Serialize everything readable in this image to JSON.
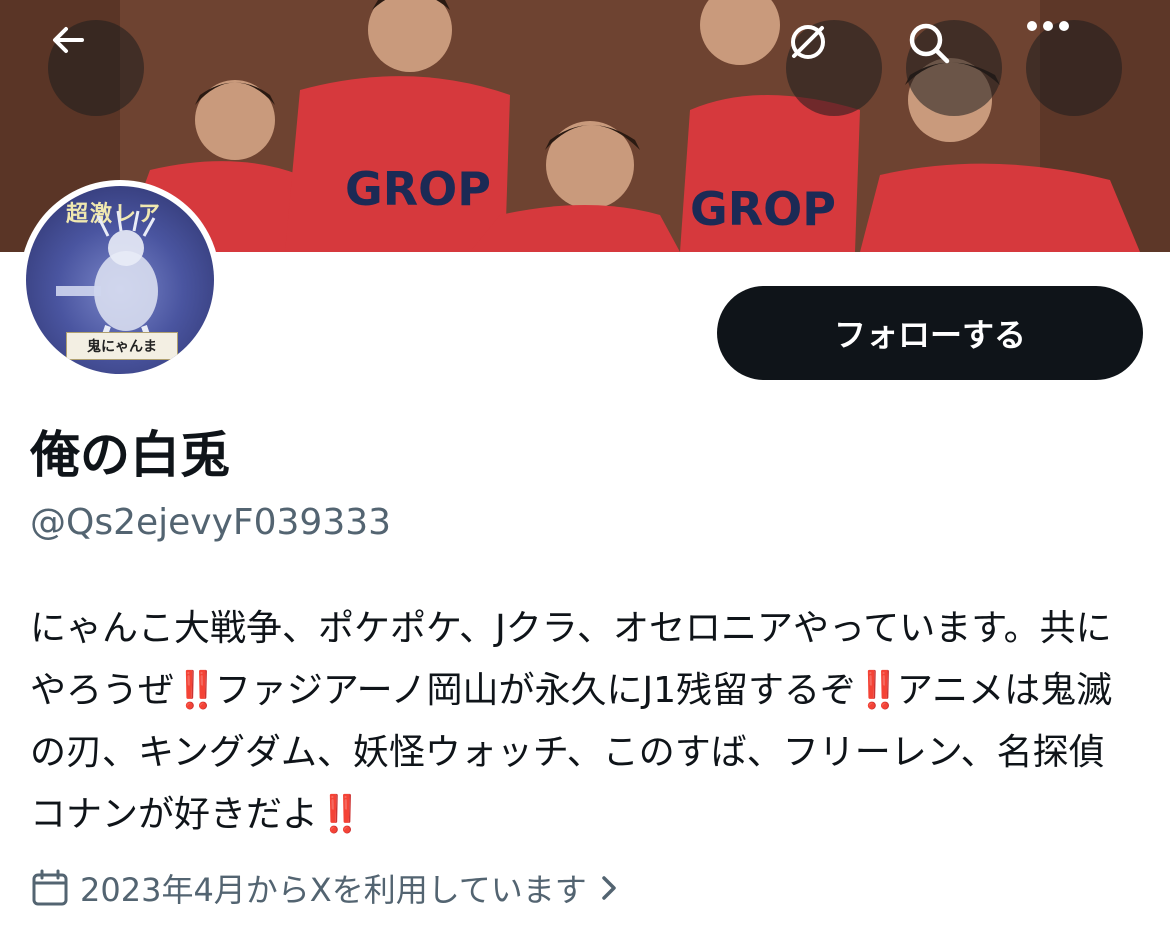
{
  "header": {
    "back_icon": "arrow-left-icon",
    "grok_icon": "grok-icon",
    "search_icon": "search-icon",
    "more_icon": "more-horizontal-icon"
  },
  "banner": {
    "jersey_text": "GROP"
  },
  "avatar": {
    "top_text": "超激レア",
    "caption": "鬼にゃんま"
  },
  "profile": {
    "follow_label": "フォローする",
    "display_name": "俺の白兎",
    "handle": "@Qs2ejevyF039333",
    "bio_parts": [
      "にゃんこ大戦争、ポケポケ、Jクラ、オセロニアやっています。共にやろうぜ",
      "ファジアーノ岡山が永久にJ1残留するぞ",
      "アニメは鬼滅の刃、キングダム、妖怪ウォッチ、このすば、フリーレン、名探偵コナンが好きだよ"
    ],
    "bio_emoji": "‼️",
    "joined_icon": "calendar-icon",
    "joined_text": "2023年4月からXを利用しています",
    "joined_chevron": "chevron-right-icon"
  },
  "colors": {
    "accent_dark": "#0f1419",
    "secondary_text": "#536471",
    "emoji_red": "#e0245e",
    "jersey_red": "#d6393d"
  }
}
